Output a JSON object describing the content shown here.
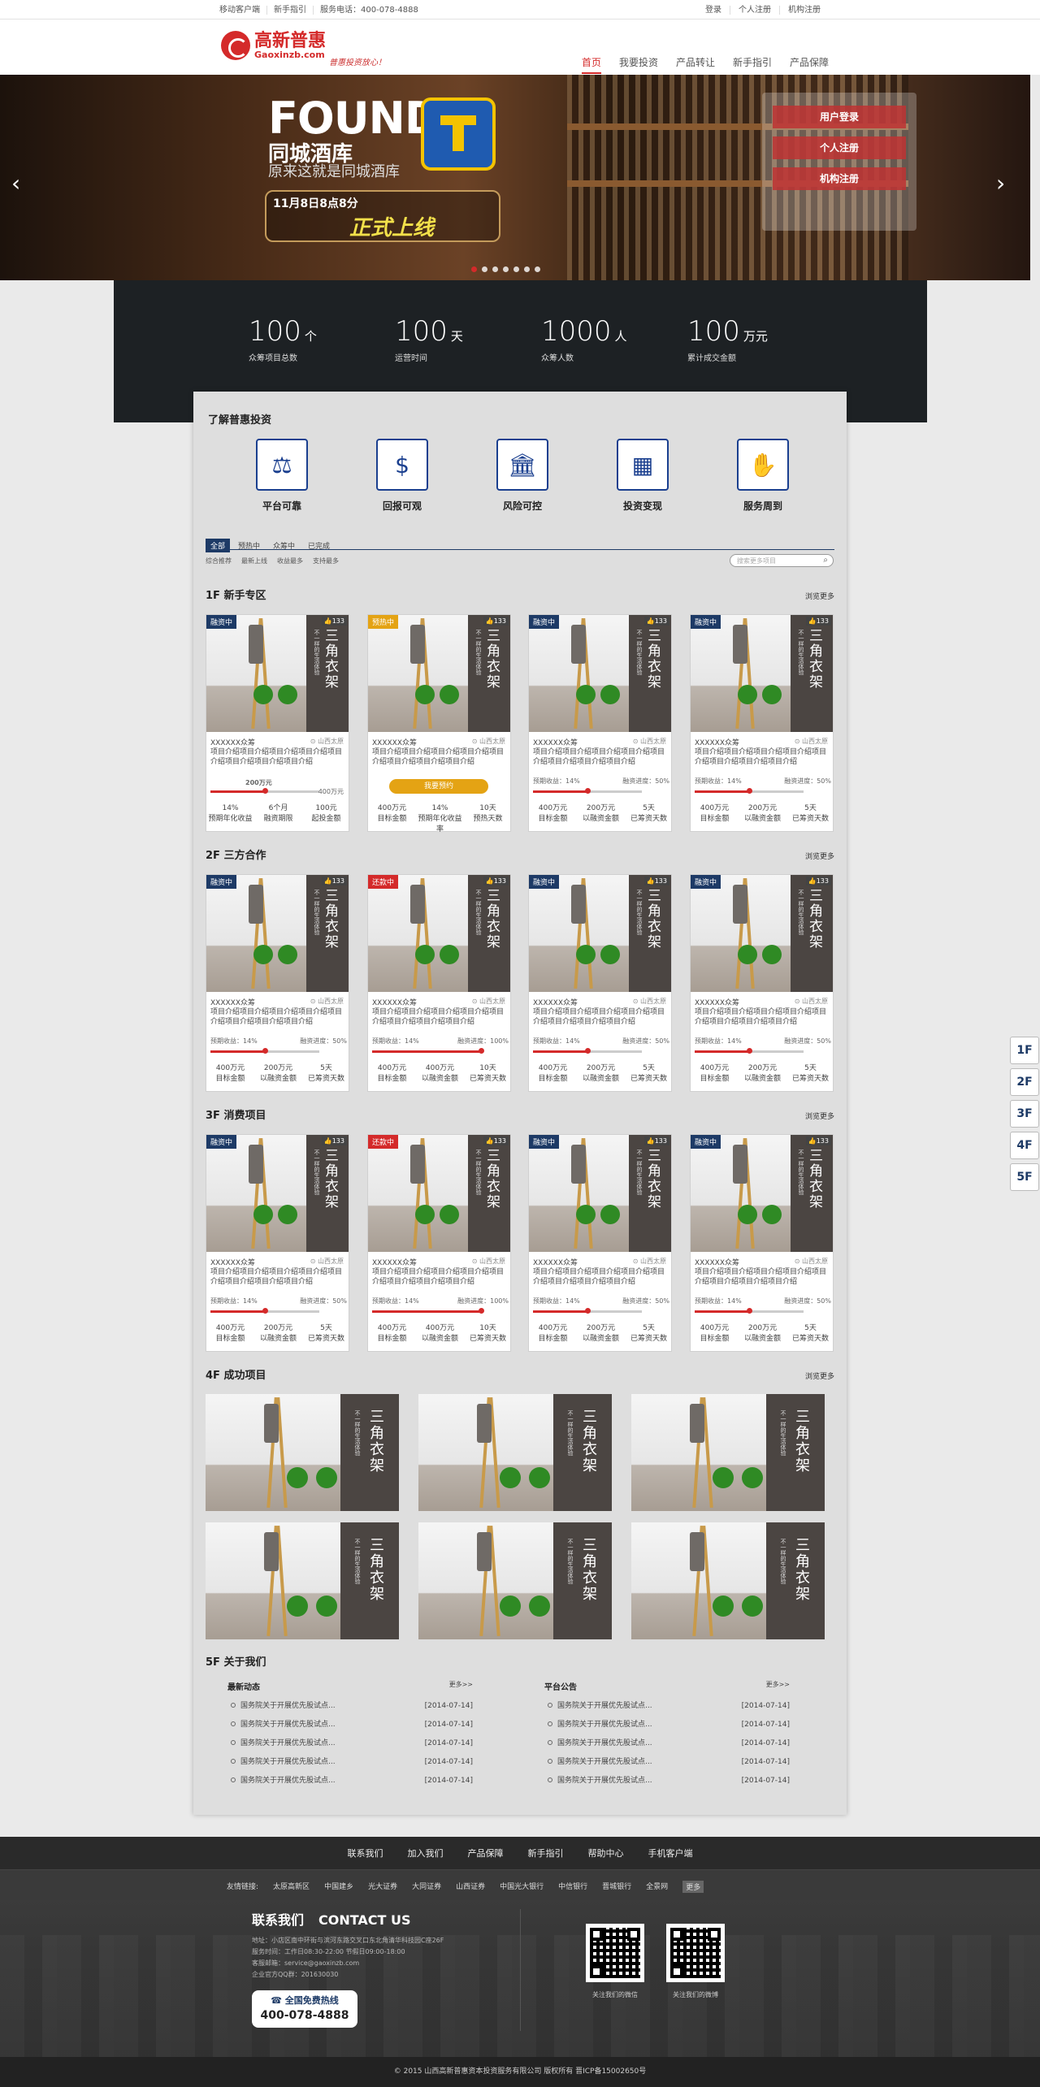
{
  "topbar": {
    "mobile": "移动客户端",
    "guide": "新手指引",
    "phone": "服务电话：400-078-4888",
    "login": "登录",
    "center": "个人注册",
    "org": "机构注册"
  },
  "logo": {
    "cn": "高新普惠",
    "en": "Gaoxinzb.com",
    "slogan": "普惠投资放心！"
  },
  "nav": [
    "首页",
    "我要投资",
    "产品转让",
    "新手指引",
    "产品保障"
  ],
  "banner": {
    "found": "FOUND",
    "sub": "同城酒库",
    "sub2": "原来这就是同城酒库",
    "date": "11月8日8点8分",
    "launch": "正式上线",
    "btn_login": "用户登录",
    "btn_person": "个人注册",
    "btn_org": "机构注册",
    "prev": "‹",
    "next": "›"
  },
  "stats": [
    {
      "num": "100",
      "unit": "个",
      "label": "众筹项目总数"
    },
    {
      "num": "100",
      "unit": "天",
      "label": "运营时间"
    },
    {
      "num": "1000",
      "unit": "人",
      "label": "众筹人数"
    },
    {
      "num": "100",
      "unit": "万元",
      "label": "累计成交金额"
    }
  ],
  "features": {
    "title": "了解普惠投资",
    "items": [
      {
        "icon": "gavel-icon",
        "glyph": "⚖",
        "label": "平台可靠"
      },
      {
        "icon": "cash-icon",
        "glyph": "$",
        "label": "回报可观"
      },
      {
        "icon": "bank-icon",
        "glyph": "🏛",
        "label": "风险可控"
      },
      {
        "icon": "calculator-icon",
        "glyph": "▦",
        "label": "投资变现"
      },
      {
        "icon": "handshake-icon",
        "glyph": "✋",
        "label": "服务周到"
      }
    ]
  },
  "tabs": [
    "全部",
    "预热中",
    "众筹中",
    "已完成"
  ],
  "subtabs": [
    "综合推荐",
    "最新上线",
    "收益最多",
    "支持最多"
  ],
  "search_placeholder": "搜索更多项目",
  "floors": [
    {
      "title": "1F 新手专区",
      "more": "浏览更多"
    },
    {
      "title": "2F 三方合作",
      "more": "浏览更多"
    },
    {
      "title": "3F 消费项目",
      "more": "浏览更多"
    },
    {
      "title": "4F 成功项目",
      "more": "浏览更多"
    },
    {
      "title": "5F 关于我们"
    }
  ],
  "card": {
    "likes": "133",
    "name": "XXXXXX众筹",
    "loc": "山西太原",
    "desc": "项目介绍项目介绍项目介绍项目介绍项目介绍项目介绍项目介绍项目介绍",
    "desc_short": "项目介绍项目介绍项目介绍项目介绍项目介绍",
    "img_title": "三角衣架",
    "img_sub": "不一样的生活体验",
    "prog_l": "预期收益：14%",
    "prog_r50": "融资进度：50%",
    "prog_r100": "融资进度：100%"
  },
  "floor1": [
    {
      "tag": "融资中",
      "tag_color": "#1d3a66",
      "raised": "200万元",
      "total": "400万元",
      "stats": [
        [
          "14%",
          "预期年化收益"
        ],
        [
          "6个月",
          "融资期限"
        ],
        [
          "100元",
          "起投金额"
        ]
      ],
      "progress": 0.5
    },
    {
      "tag": "预热中",
      "tag_color": "#e4a314",
      "button": "我要预约",
      "stats": [
        [
          "400万元",
          "目标金额"
        ],
        [
          "14%",
          "预期年化收益率"
        ],
        [
          "10天",
          "预热天数"
        ]
      ]
    },
    {
      "tag": "融资中",
      "tag_color": "#1d3a66",
      "stats": [
        [
          "400万元",
          "目标金额"
        ],
        [
          "200万元",
          "以融资金额"
        ],
        [
          "5天",
          "已筹资天数"
        ]
      ],
      "progress": 0.5
    },
    {
      "tag": "融资中",
      "tag_color": "#1d3a66",
      "stats": [
        [
          "400万元",
          "目标金额"
        ],
        [
          "200万元",
          "以融资金额"
        ],
        [
          "5天",
          "已筹资天数"
        ]
      ],
      "progress": 0.5
    }
  ],
  "floor2": [
    {
      "tag": "融资中",
      "tag_color": "#1d3a66",
      "r": "融资进度：50%",
      "stats": [
        [
          "400万元",
          "目标金额"
        ],
        [
          "200万元",
          "以融资金额"
        ],
        [
          "5天",
          "已筹资天数"
        ]
      ],
      "progress": 0.5
    },
    {
      "tag": "还款中",
      "tag_color": "#d42a2a",
      "r": "融资进度：100%",
      "stats": [
        [
          "400万元",
          "目标金额"
        ],
        [
          "400万元",
          "以融资金额"
        ],
        [
          "10天",
          "已筹资天数"
        ]
      ],
      "progress": 1
    },
    {
      "tag": "融资中",
      "tag_color": "#1d3a66",
      "r": "融资进度：50%",
      "stats": [
        [
          "400万元",
          "目标金额"
        ],
        [
          "200万元",
          "以融资金额"
        ],
        [
          "5天",
          "已筹资天数"
        ]
      ],
      "progress": 0.5
    },
    {
      "tag": "融资中",
      "tag_color": "#1d3a66",
      "r": "融资进度：50%",
      "stats": [
        [
          "400万元",
          "目标金额"
        ],
        [
          "200万元",
          "以融资金额"
        ],
        [
          "5天",
          "已筹资天数"
        ]
      ],
      "progress": 0.5
    }
  ],
  "floor3": [
    {
      "tag": "融资中",
      "tag_color": "#1d3a66",
      "r": "融资进度：50%",
      "stats": [
        [
          "400万元",
          "目标金额"
        ],
        [
          "200万元",
          "以融资金额"
        ],
        [
          "5天",
          "已筹资天数"
        ]
      ],
      "progress": 0.5
    },
    {
      "tag": "还款中",
      "tag_color": "#d42a2a",
      "r": "融资进度：100%",
      "stats": [
        [
          "400万元",
          "目标金额"
        ],
        [
          "400万元",
          "以融资金额"
        ],
        [
          "10天",
          "已筹资天数"
        ]
      ],
      "progress": 1
    },
    {
      "tag": "融资中",
      "tag_color": "#1d3a66",
      "r": "融资进度：50%",
      "stats": [
        [
          "400万元",
          "目标金额"
        ],
        [
          "200万元",
          "以融资金额"
        ],
        [
          "5天",
          "已筹资天数"
        ]
      ],
      "progress": 0.5
    },
    {
      "tag": "融资中",
      "tag_color": "#1d3a66",
      "r": "融资进度：50%",
      "stats": [
        [
          "400万元",
          "目标金额"
        ],
        [
          "200万元",
          "以融资金额"
        ],
        [
          "5天",
          "已筹资天数"
        ]
      ],
      "progress": 0.5
    }
  ],
  "news": {
    "left_title": "最新动态",
    "right_title": "平台公告",
    "more": "更多>>",
    "item": "国务院关于开展优先股试点...",
    "date": "[2014-07-14]"
  },
  "floor_nav": [
    "1F",
    "2F",
    "3F",
    "4F",
    "5F"
  ],
  "footer_nav": [
    "联系我们",
    "加入我们",
    "产品保障",
    "新手指引",
    "帮助中心",
    "手机客户端"
  ],
  "links": [
    "友情链接:",
    "太原高新区",
    "中国建乡",
    "光大证券",
    "大同证券",
    "山西证券",
    "中国光大银行",
    "中信银行",
    "晋城银行",
    "全景网",
    "更多"
  ],
  "contact": {
    "title": "联系我们",
    "en": "CONTACT US",
    "addr": "地址：小店区南中环街与滨河东路交叉口东北角清华科技园C座26F",
    "hours": "服务时间：工作日08:30-22:00 节假日09:00-18:00",
    "email": "客服邮箱：service@gaoxinzb.com",
    "qq": "企业官方QQ群：201630030",
    "hot1": "全国免费热线",
    "hot2": "400-078-4888"
  },
  "qr": {
    "l1": "关注我们的微信",
    "l2": "关注我们的微博"
  },
  "copyright": "© 2015 山西高新普惠资本投资服务有限公司 版权所有 晋ICP备15002650号"
}
